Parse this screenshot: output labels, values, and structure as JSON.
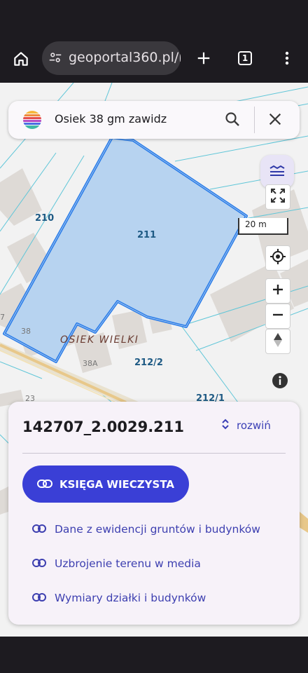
{
  "browser": {
    "url": "geoportal360.pl/r",
    "tab_count": "1"
  },
  "search": {
    "query": "Osiek 38 gm zawidz"
  },
  "map": {
    "scale_label": "20 m",
    "parcel_labels": [
      "210",
      "211",
      "212/2",
      "212/1"
    ],
    "building_numbers": [
      "38",
      "38A",
      "23",
      "7"
    ],
    "place_name": "OSIEK WIELKI",
    "highlight_color": "#2b7de9",
    "parcel_fill_color": "#b7d3f0"
  },
  "panel": {
    "parcel_id": "142707_2.0029.211",
    "expand_label": "rozwiń",
    "primary_button": "KSIĘGA WIECZYSTA",
    "links": [
      "Dane z ewidencji gruntów i budynków",
      "Uzbrojenie terenu w media",
      "Wymiary działki i budynków"
    ]
  },
  "icons": [
    "home-icon",
    "tune-icon",
    "new-tab-icon",
    "tabs-icon",
    "more-vert-icon",
    "rainbow-logo-icon",
    "search-icon",
    "close-icon",
    "layers-icon",
    "fullscreen-icon",
    "locate-icon",
    "zoom-in-icon",
    "zoom-out-icon",
    "compass-icon",
    "info-icon",
    "unfold-icon",
    "link-icon"
  ]
}
